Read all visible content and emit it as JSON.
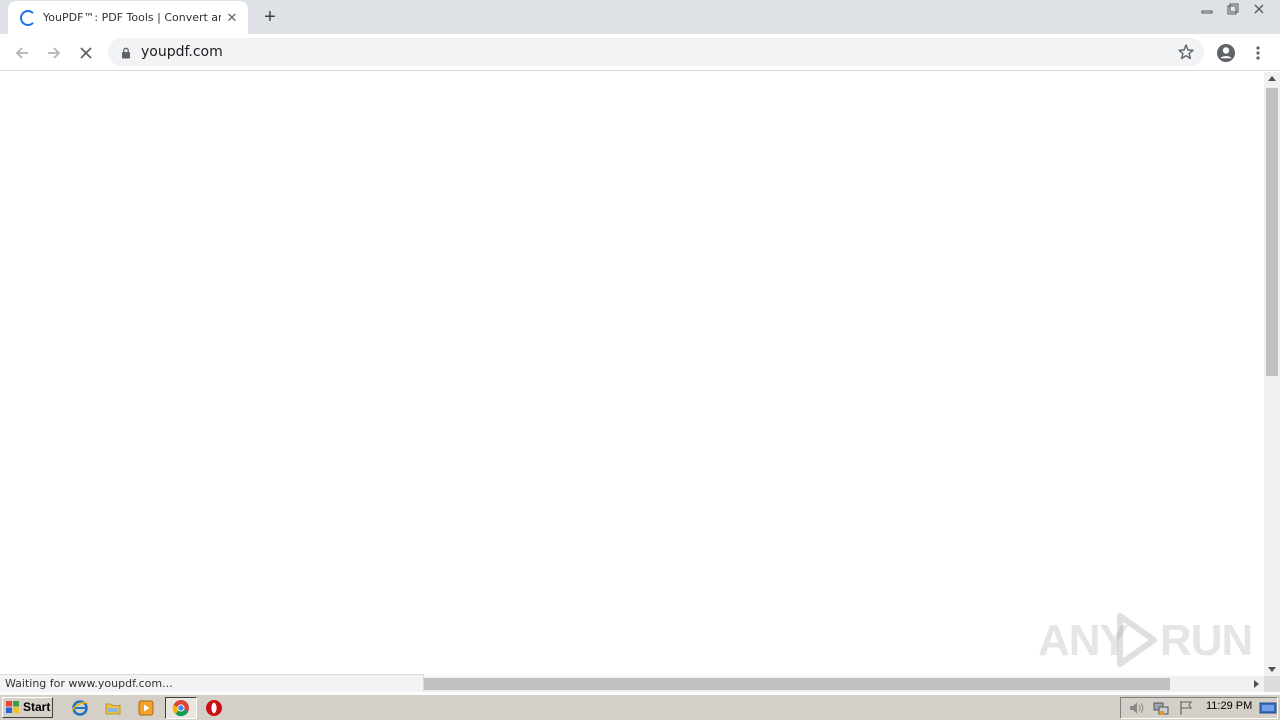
{
  "browser": {
    "tab": {
      "title": "YouPDF™: PDF Tools | Convert any PDF",
      "loading_icon": "spinner-icon",
      "close_icon": "close-icon"
    },
    "new_tab_label": "+",
    "window_controls": [
      "minimize-icon",
      "restore-icon",
      "close-icon"
    ],
    "toolbar": {
      "back_icon": "back-arrow-icon",
      "forward_icon": "forward-arrow-icon",
      "stop_icon": "stop-icon",
      "url": "youpdf.com",
      "lock_icon": "lock-icon",
      "star_icon": "star-icon",
      "profile_icon": "account-icon",
      "menu_icon": "kebab-menu-icon"
    },
    "status": "Waiting for www.youpdf.com..."
  },
  "watermark": {
    "text_left": "ANY",
    "text_right": "RUN"
  },
  "taskbar": {
    "start_label": "Start",
    "apps": [
      "ie-icon",
      "explorer-icon",
      "media-player-icon",
      "chrome-icon",
      "opera-icon"
    ],
    "tray_icons": [
      "volume-icon",
      "network-icon",
      "flag-icon"
    ],
    "clock": "11:29 PM",
    "show_desktop_icon": "desktop-icon"
  },
  "colors": {
    "tabstrip": "#dee1e6",
    "accent": "#1a73e8",
    "taskbar": "#d4d0c8"
  }
}
